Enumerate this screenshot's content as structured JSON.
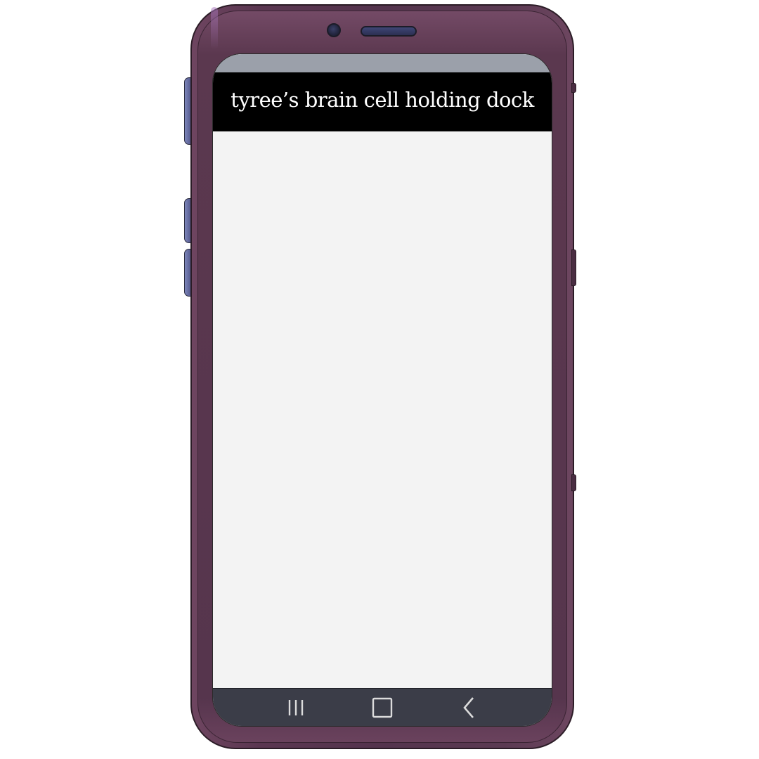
{
  "app": {
    "title": "tyree’s brain cell holding dock"
  },
  "navigation": {
    "recents_icon": "recents-icon",
    "home_icon": "home-icon",
    "back_icon": "back-icon"
  },
  "colors": {
    "phone_body": "#56354d",
    "side_buttons": "#6a70a6",
    "status_bar": "#9ba0aa",
    "header_bg": "#000000",
    "header_text": "#ffffff",
    "content_bg": "#f3f3f3",
    "nav_bar": "#3b3d48",
    "nav_icons": "#dcdcdc"
  }
}
